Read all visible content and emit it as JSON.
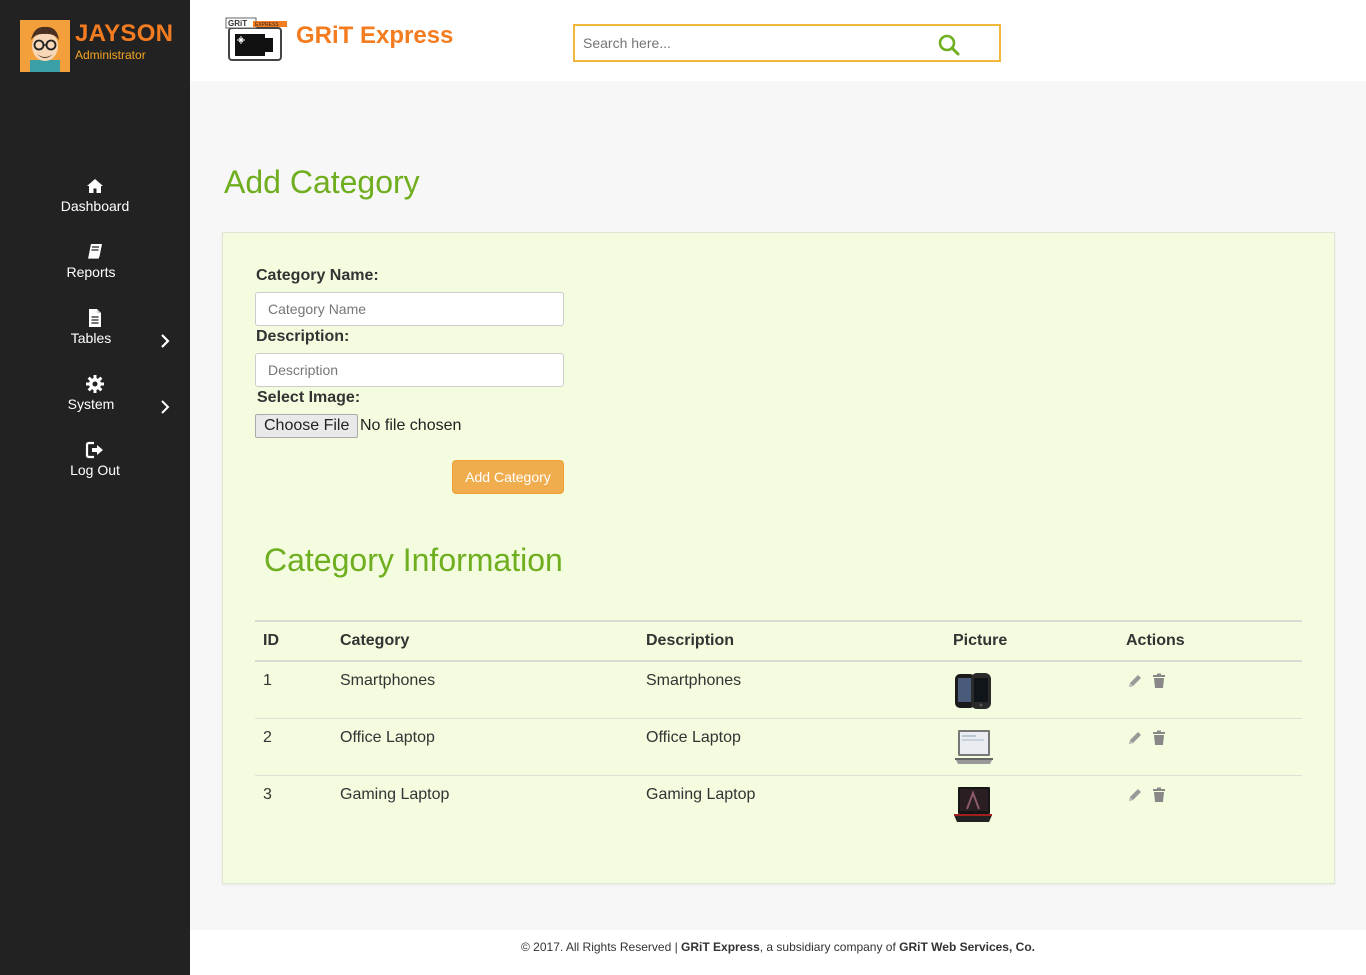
{
  "profile": {
    "name": "JAYSON",
    "role": "Administrator"
  },
  "nav": {
    "items": [
      {
        "label": "Dashboard",
        "icon": "home-icon",
        "has_children": false
      },
      {
        "label": "Reports",
        "icon": "book-icon",
        "has_children": true
      },
      {
        "label": "Tables",
        "icon": "file-icon",
        "has_children": true
      },
      {
        "label": "System",
        "icon": "gear-icon",
        "has_children": true
      },
      {
        "label": "Log Out",
        "icon": "logout-icon",
        "has_children": false
      }
    ]
  },
  "header": {
    "brand": "GRiT Express",
    "search": {
      "placeholder": "Search here...",
      "value": ""
    }
  },
  "page": {
    "title": "Add Category"
  },
  "form": {
    "category_name_label": "Category Name:",
    "category_name_placeholder": "Category Name",
    "description_label": "Description:",
    "description_placeholder": "Description",
    "image_label": "Select Image:",
    "file_button": "Choose File",
    "file_status": "No file chosen",
    "submit": "Add Category"
  },
  "table": {
    "title": "Category Information",
    "headers": [
      "ID",
      "Category",
      "Description",
      "Picture",
      "Actions"
    ],
    "rows": [
      {
        "id": "1",
        "category": "Smartphones",
        "description": "Smartphones",
        "picture": "smartphones-thumbnail"
      },
      {
        "id": "2",
        "category": "Office Laptop",
        "description": "Office Laptop",
        "picture": "office-laptop-thumbnail"
      },
      {
        "id": "3",
        "category": "Gaming Laptop",
        "description": "Gaming Laptop",
        "picture": "gaming-laptop-thumbnail"
      }
    ]
  },
  "footer": {
    "prefix": "© 2017. All Rights Reserved | ",
    "brand": "GRiT Express",
    "middle": ", a subsidiary company of ",
    "company": "GRiT Web Services, Co."
  },
  "colors": {
    "accent_green": "#6fae1f",
    "accent_orange": "#f47c20",
    "sidebar_bg": "#222222",
    "panel_bg": "#f3fcdf",
    "button_orange": "#f0ad4e"
  }
}
